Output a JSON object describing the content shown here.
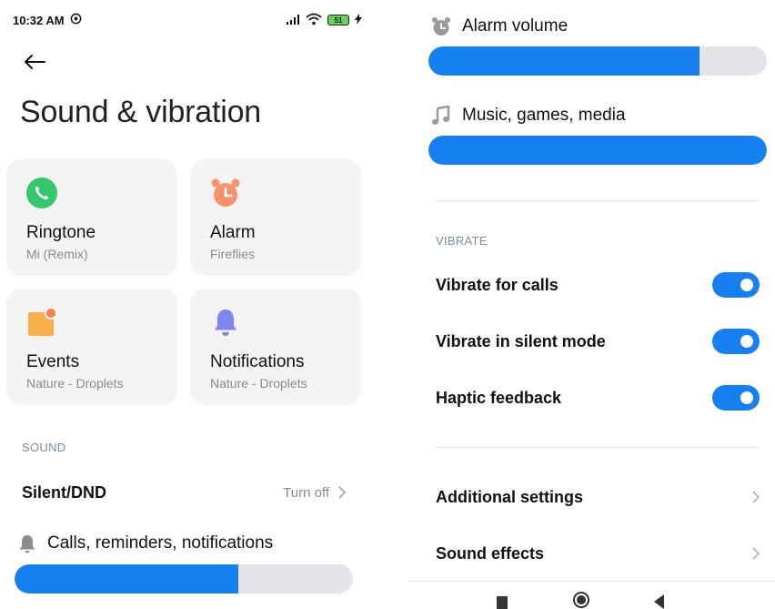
{
  "status_bar": {
    "time": "10:32 AM",
    "battery": "51"
  },
  "page": {
    "title": "Sound & vibration"
  },
  "tiles": [
    {
      "title": "Ringtone",
      "subtitle": "Mi (Remix)",
      "icon": "phone-icon",
      "color": "#34c76b"
    },
    {
      "title": "Alarm",
      "subtitle": "Fireflies",
      "icon": "alarm-clock-icon",
      "color": "#f7926b"
    },
    {
      "title": "Events",
      "subtitle": "Nature - Droplets",
      "icon": "calendar-event-icon",
      "color": "#f9b04a"
    },
    {
      "title": "Notifications",
      "subtitle": "Nature - Droplets",
      "icon": "bell-icon",
      "color": "#7c86f5"
    }
  ],
  "sound": {
    "section_label": "SOUND",
    "silent_dnd": {
      "label": "Silent/DND",
      "value": "Turn off"
    },
    "volumes": [
      {
        "label": "Calls, reminders, notifications",
        "icon": "bell-icon",
        "level": 0.66
      },
      {
        "label": "Alarm volume",
        "icon": "alarm-clock-icon",
        "level": 0.8
      },
      {
        "label": "Music, games, media",
        "icon": "music-note-icon",
        "level": 1.0
      }
    ]
  },
  "vibrate": {
    "section_label": "VIBRATE",
    "toggles": [
      {
        "label": "Vibrate for calls",
        "on": true
      },
      {
        "label": "Vibrate in silent mode",
        "on": true
      },
      {
        "label": "Haptic feedback",
        "on": true
      }
    ]
  },
  "more": {
    "additional_settings": "Additional settings",
    "sound_effects": "Sound effects"
  },
  "colors": {
    "accent": "#1680f0",
    "track": "#e3e5ea",
    "tile_bg": "#f4f4f5"
  }
}
